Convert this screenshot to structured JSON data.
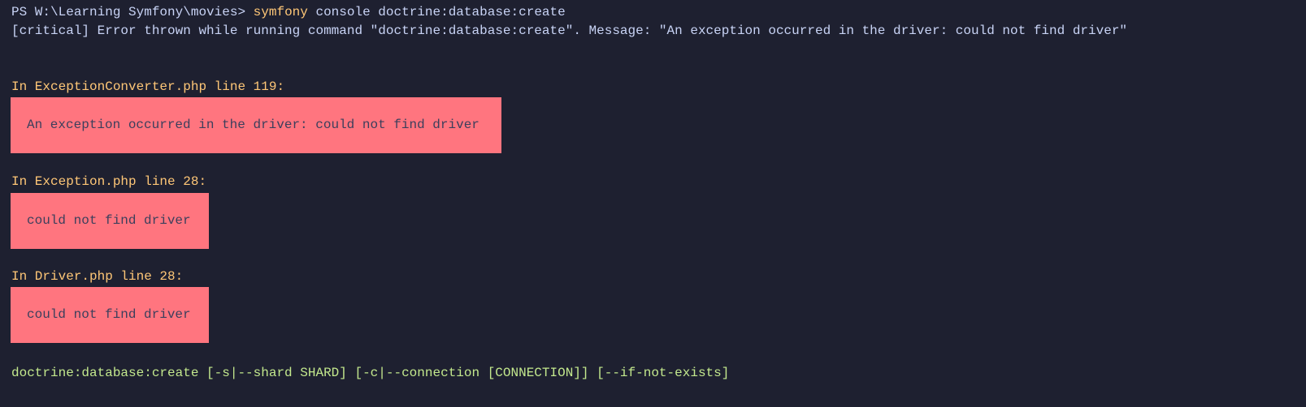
{
  "terminal": {
    "prompt": "PS W:\\Learning Symfony\\movies> ",
    "command_name": "symfony",
    "command_args": " console doctrine:database:create",
    "critical_message": "[critical] Error thrown while running command \"doctrine:database:create\". Message: \"An exception occurred in the driver: could not find driver\"",
    "exceptions": [
      {
        "location": "In ExceptionConverter.php line 119:",
        "message": "An exception occurred in the driver: could not find driver"
      },
      {
        "location": "In Exception.php line 28:",
        "message": "could not find driver"
      },
      {
        "location": "In Driver.php line 28:",
        "message": "could not find driver"
      }
    ],
    "usage": "doctrine:database:create [-s|--shard SHARD] [-c|--connection [CONNECTION]] [--if-not-exists]"
  },
  "colors": {
    "background": "#1e2030",
    "text": "#c8d3f5",
    "highlight": "#ffc777",
    "error_box": "#ff757f",
    "usage": "#c3e88d"
  }
}
